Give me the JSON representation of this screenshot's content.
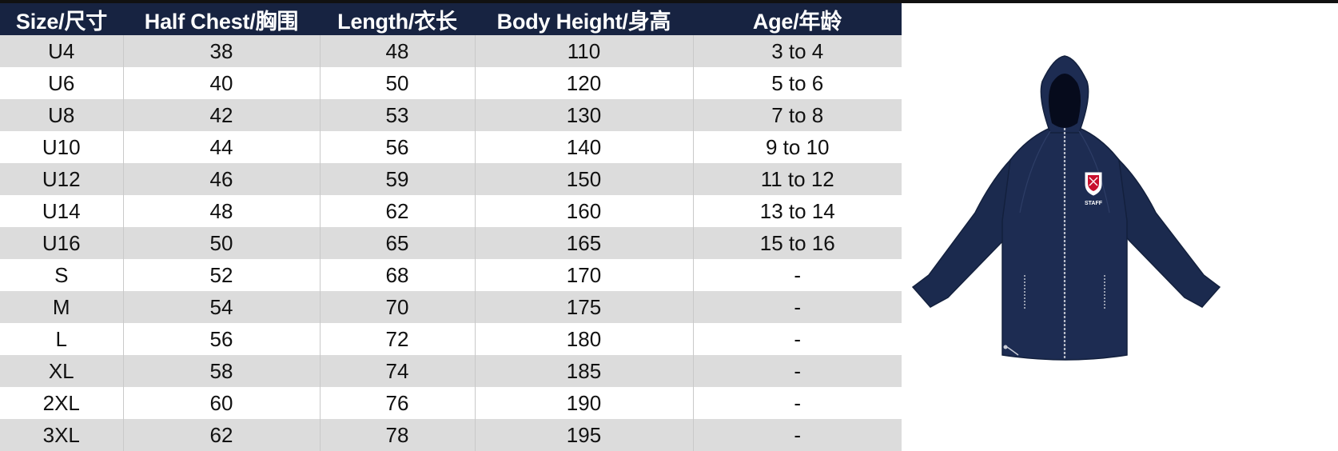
{
  "size_chart": {
    "columns": [
      "Size/尺寸",
      "Half Chest/胸围",
      "Length/衣长",
      "Body Height/身高",
      "Age/年龄"
    ],
    "rows": [
      [
        "U4",
        "38",
        "48",
        "110",
        "3 to 4"
      ],
      [
        "U6",
        "40",
        "50",
        "120",
        "5 to 6"
      ],
      [
        "U8",
        "42",
        "53",
        "130",
        "7 to 8"
      ],
      [
        "U10",
        "44",
        "56",
        "140",
        "9 to 10"
      ],
      [
        "U12",
        "46",
        "59",
        "150",
        "11 to 12"
      ],
      [
        "U14",
        "48",
        "62",
        "160",
        "13 to 14"
      ],
      [
        "U16",
        "50",
        "65",
        "165",
        "15 to 16"
      ],
      [
        "S",
        "52",
        "68",
        "170",
        "-"
      ],
      [
        "M",
        "54",
        "70",
        "175",
        "-"
      ],
      [
        "L",
        "56",
        "72",
        "180",
        "-"
      ],
      [
        "XL",
        "58",
        "74",
        "185",
        "-"
      ],
      [
        "2XL",
        "60",
        "76",
        "190",
        "-"
      ],
      [
        "3XL",
        "62",
        "78",
        "195",
        "-"
      ]
    ]
  },
  "product_image": {
    "icon": "hooded-jacket-icon",
    "badge_text": "STAFF",
    "jacket_color": "#1b2a4e"
  },
  "colors": {
    "header_background": "#172341",
    "header_text": "#ffffff",
    "row_shade": "#dcdcdc",
    "row_plain": "#ffffff"
  }
}
